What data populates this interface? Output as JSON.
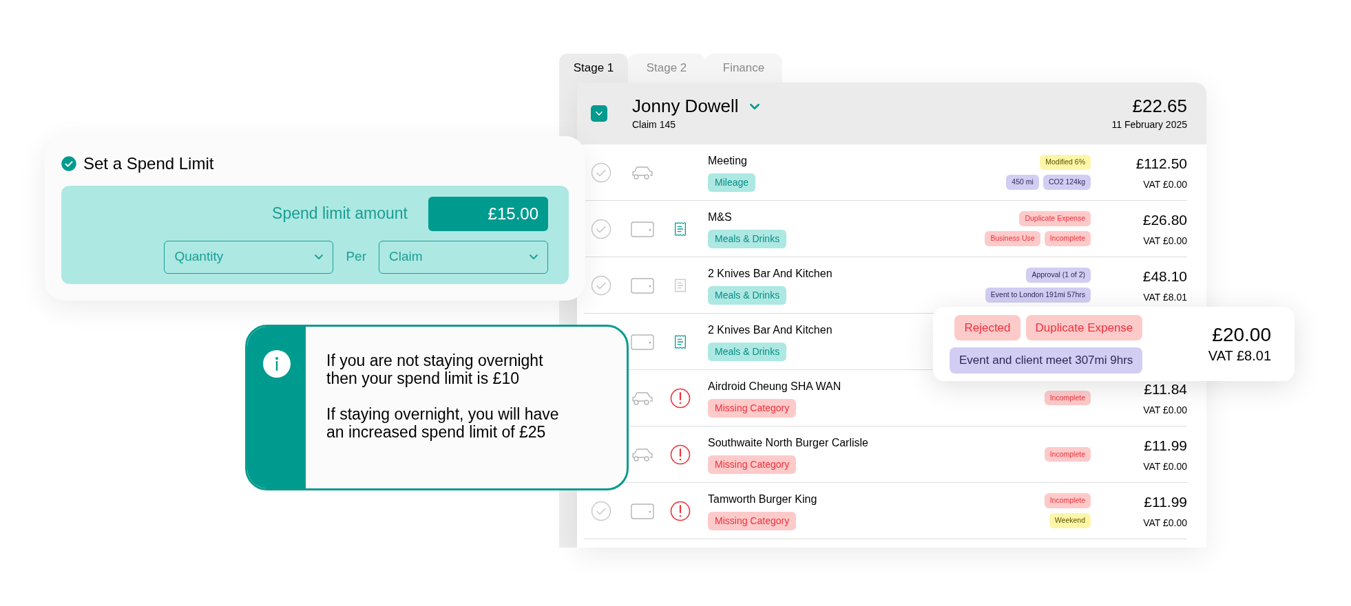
{
  "tabs": [
    {
      "label": "Stage 1",
      "selected": true
    },
    {
      "label": "Stage 2",
      "selected": false
    },
    {
      "label": "Finance",
      "selected": false
    }
  ],
  "claim": {
    "checked": true,
    "name": "Jonny Dowell",
    "number": "Claim 145",
    "total": "£22.65",
    "date": "11 February 2025"
  },
  "expenses": [
    {
      "title": "Meeting",
      "category": {
        "label": "Mileage",
        "kind": "category"
      },
      "kind": "car",
      "approved": false,
      "tag_lines": [
        [
          {
            "label": "Modified 6%",
            "kind": "warning"
          }
        ],
        [
          {
            "label": "450 mi",
            "kind": "info"
          },
          {
            "label": "CO2 124kg",
            "kind": "info"
          }
        ]
      ],
      "amount": "£112.50",
      "vat": "VAT £0.00"
    },
    {
      "title": "M&S",
      "category": {
        "label": "Meals & Drinks",
        "kind": "category"
      },
      "kind": "wallet",
      "receipt_attached": true,
      "approved": false,
      "tag_lines": [
        [
          {
            "label": "Duplicate Expense",
            "kind": "error"
          }
        ],
        [
          {
            "label": "Business Use",
            "kind": "error"
          },
          {
            "label": "Incomplete",
            "kind": "error"
          }
        ]
      ],
      "amount": "£26.80",
      "vat": "VAT £0.00"
    },
    {
      "title": "2 Knives Bar And Kitchen",
      "category": {
        "label": "Meals & Drinks",
        "kind": "category"
      },
      "kind": "wallet",
      "receipt_attached": false,
      "approved": false,
      "tag_lines": [
        [
          {
            "label": "Approval (1 of 2)",
            "kind": "info"
          }
        ],
        [
          {
            "label": "Event to London 191mi 57hrs",
            "kind": "info"
          }
        ]
      ],
      "amount": "£48.10",
      "vat": "VAT £8.01"
    },
    {
      "title": "2 Knives Bar And Kitchen",
      "category": {
        "label": "Meals & Drinks",
        "kind": "category"
      },
      "kind": "wallet",
      "receipt_attached": true
    },
    {
      "title": "Airdroid Cheung SHA WAN",
      "category": {
        "label": "Missing Category",
        "kind": "missing"
      },
      "kind": "car",
      "flagged": true,
      "tag_lines": [
        [
          {
            "label": "Incomplete",
            "kind": "error"
          }
        ]
      ],
      "amount": "£11.84",
      "vat": "VAT £0.00"
    },
    {
      "title": "Southwaite North Burger Carlisle",
      "category": {
        "label": "Missing Category",
        "kind": "missing"
      },
      "kind": "car",
      "flagged": true,
      "tag_lines": [
        [
          {
            "label": "Incomplete",
            "kind": "error"
          }
        ]
      ],
      "amount": "£11.99",
      "vat": "VAT £0.00"
    },
    {
      "title": "Tamworth Burger King",
      "category": {
        "label": "Missing Category",
        "kind": "missing"
      },
      "kind": "wallet",
      "flagged": true,
      "approved": false,
      "tag_lines": [
        [
          {
            "label": "Incomplete",
            "kind": "error"
          }
        ],
        [
          {
            "label": "Weekend",
            "kind": "warning"
          }
        ]
      ],
      "amount": "£11.99",
      "vat": "VAT £0.00"
    }
  ],
  "popup": {
    "tag_lines": [
      [
        {
          "label": "Rejected",
          "kind": "error"
        },
        {
          "label": "Duplicate Expense",
          "kind": "error"
        }
      ],
      [
        {
          "label": "Event and client meet 307mi 9hrs",
          "kind": "info"
        }
      ]
    ],
    "amount": "£20.00",
    "vat": "VAT £8.01"
  },
  "spend_limit": {
    "enabled": true,
    "title": "Set a Spend Limit",
    "amount_label": "Spend limit amount",
    "amount": "£15.00",
    "measure": "Quantity",
    "per_label": "Per",
    "period": "Claim"
  },
  "info_note": {
    "paragraphs": [
      "If you are not staying overnight\nthen your spend limit is £10",
      "If staying overnight, you will have\nan increased spend limit of £25"
    ]
  }
}
